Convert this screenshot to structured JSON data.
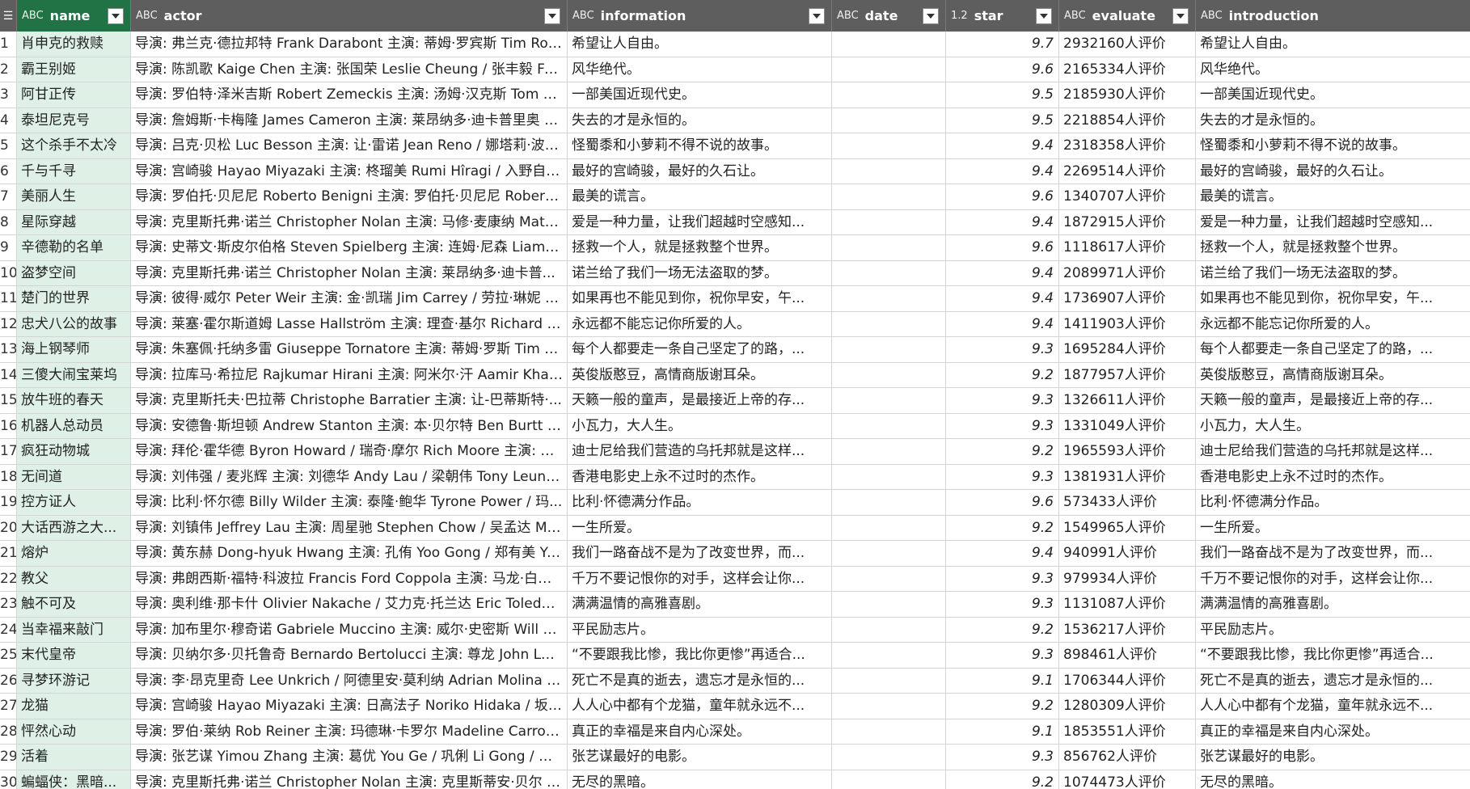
{
  "columns": [
    {
      "type": "ABC",
      "label": "name"
    },
    {
      "type": "ABC",
      "label": "actor"
    },
    {
      "type": "ABC",
      "label": "information"
    },
    {
      "type": "ABC",
      "label": "date"
    },
    {
      "type": "1.2",
      "label": "star"
    },
    {
      "type": "ABC",
      "label": "evaluate"
    },
    {
      "type": "ABC",
      "label": "introduction"
    }
  ],
  "rows": [
    {
      "num": "1",
      "name": "肖申克的救赎",
      "actor": "导演: 弗兰克·德拉邦特 Frank Darabont 主演: 蒂姆·罗宾斯 Tim Rob...",
      "information": "希望让人自由。",
      "date": "",
      "star": "9.7",
      "evaluate": "2932160人评价",
      "introduction": "希望让人自由。"
    },
    {
      "num": "2",
      "name": "霸王别姬",
      "actor": "导演: 陈凯歌 Kaige Chen 主演: 张国荣 Leslie Cheung / 张丰毅 Fengy...",
      "information": "风华绝代。",
      "date": "",
      "star": "9.6",
      "evaluate": "2165334人评价",
      "introduction": "风华绝代。"
    },
    {
      "num": "3",
      "name": "阿甘正传",
      "actor": "导演: 罗伯特·泽米吉斯 Robert Zemeckis 主演: 汤姆·汉克斯 Tom Ha...",
      "information": "一部美国近现代史。",
      "date": "",
      "star": "9.5",
      "evaluate": "2185930人评价",
      "introduction": "一部美国近现代史。"
    },
    {
      "num": "4",
      "name": "泰坦尼克号",
      "actor": "导演: 詹姆斯·卡梅隆 James Cameron 主演: 莱昂纳多·迪卡普里奥 L...",
      "information": "失去的才是永恒的。",
      "date": "",
      "star": "9.5",
      "evaluate": "2218854人评价",
      "introduction": "失去的才是永恒的。"
    },
    {
      "num": "5",
      "name": "这个杀手不太冷",
      "actor": "导演: 吕克·贝松 Luc Besson 主演: 让·雷诺 Jean Reno / 娜塔莉·波特...",
      "information": "怪蜀黍和小萝莉不得不说的故事。",
      "date": "",
      "star": "9.4",
      "evaluate": "2318358人评价",
      "introduction": "怪蜀黍和小萝莉不得不说的故事。"
    },
    {
      "num": "6",
      "name": "千与千寻",
      "actor": "导演: 宫崎骏 Hayao Miyazaki 主演: 柊瑠美 Rumi Hîragi / 入野自由 ...",
      "information": "最好的宫崎骏，最好的久石让。",
      "date": "",
      "star": "9.4",
      "evaluate": "2269514人评价",
      "introduction": "最好的宫崎骏，最好的久石让。"
    },
    {
      "num": "7",
      "name": "美丽人生",
      "actor": "导演: 罗伯托·贝尼尼 Roberto Benigni 主演: 罗伯托·贝尼尼 Roberto ...",
      "information": "最美的谎言。",
      "date": "",
      "star": "9.6",
      "evaluate": "1340707人评价",
      "introduction": "最美的谎言。"
    },
    {
      "num": "8",
      "name": "星际穿越",
      "actor": "导演: 克里斯托弗·诺兰 Christopher Nolan 主演: 马修·麦康纳 Matth...",
      "information": "爱是一种力量，让我们超越时空感知...",
      "date": "",
      "star": "9.4",
      "evaluate": "1872915人评价",
      "introduction": "爱是一种力量，让我们超越时空感知..."
    },
    {
      "num": "9",
      "name": "辛德勒的名单",
      "actor": "导演: 史蒂文·斯皮尔伯格 Steven Spielberg 主演: 连姆·尼森 Liam Ne...",
      "information": "拯救一个人，就是拯救整个世界。",
      "date": "",
      "star": "9.6",
      "evaluate": "1118617人评价",
      "introduction": "拯救一个人，就是拯救整个世界。"
    },
    {
      "num": "10",
      "name": "盗梦空间",
      "actor": "导演: 克里斯托弗·诺兰 Christopher Nolan 主演: 莱昂纳多·迪卡普...",
      "information": "诺兰给了我们一场无法盗取的梦。",
      "date": "",
      "star": "9.4",
      "evaluate": "2089971人评价",
      "introduction": "诺兰给了我们一场无法盗取的梦。"
    },
    {
      "num": "11",
      "name": "楚门的世界",
      "actor": "导演: 彼得·威尔 Peter Weir 主演: 金·凯瑞 Jim Carrey / 劳拉·琳妮 La...",
      "information": "如果再也不能见到你，祝你早安，午...",
      "date": "",
      "star": "9.4",
      "evaluate": "1736907人评价",
      "introduction": "如果再也不能见到你，祝你早安，午..."
    },
    {
      "num": "12",
      "name": "忠犬八公的故事",
      "actor": "导演: 莱塞·霍尔斯道姆 Lasse Hallström 主演: 理查·基尔 Richard Ge...",
      "information": "永远都不能忘记你所爱的人。",
      "date": "",
      "star": "9.4",
      "evaluate": "1411903人评价",
      "introduction": "永远都不能忘记你所爱的人。"
    },
    {
      "num": "13",
      "name": "海上钢琴师",
      "actor": "导演: 朱塞佩·托纳多雷 Giuseppe Tornatore 主演: 蒂姆·罗斯 Tim Ro...",
      "information": "每个人都要走一条自己坚定了的路，...",
      "date": "",
      "star": "9.3",
      "evaluate": "1695284人评价",
      "introduction": "每个人都要走一条自己坚定了的路，..."
    },
    {
      "num": "14",
      "name": "三傻大闹宝莱坞",
      "actor": "导演: 拉库马·希拉尼 Rajkumar Hirani 主演: 阿米尔·汗 Aamir Khan / ...",
      "information": "英俊版憨豆，高情商版谢耳朵。",
      "date": "",
      "star": "9.2",
      "evaluate": "1877957人评价",
      "introduction": "英俊版憨豆，高情商版谢耳朵。"
    },
    {
      "num": "15",
      "name": "放牛班的春天",
      "actor": "导演: 克里斯托夫·巴拉蒂 Christophe Barratier 主演: 让-巴蒂斯特·...",
      "information": "天籁一般的童声，是最接近上帝的存...",
      "date": "",
      "star": "9.3",
      "evaluate": "1326611人评价",
      "introduction": "天籁一般的童声，是最接近上帝的存..."
    },
    {
      "num": "16",
      "name": "机器人总动员",
      "actor": "导演: 安德鲁·斯坦顿 Andrew Stanton 主演: 本·贝尔特 Ben Burtt / ...",
      "information": "小瓦力，大人生。",
      "date": "",
      "star": "9.3",
      "evaluate": "1331049人评价",
      "introduction": "小瓦力，大人生。"
    },
    {
      "num": "17",
      "name": "疯狂动物城",
      "actor": "导演: 拜伦·霍华德 Byron Howard / 瑞奇·摩尔 Rich Moore 主演: 金...",
      "information": "迪士尼给我们营造的乌托邦就是这样...",
      "date": "",
      "star": "9.2",
      "evaluate": "1965593人评价",
      "introduction": "迪士尼给我们营造的乌托邦就是这样..."
    },
    {
      "num": "18",
      "name": "无间道",
      "actor": "导演: 刘伟强 / 麦兆辉 主演: 刘德华 Andy Lau / 梁朝伟 Tony Leung ...",
      "information": "香港电影史上永不过时的杰作。",
      "date": "",
      "star": "9.3",
      "evaluate": "1381931人评价",
      "introduction": "香港电影史上永不过时的杰作。"
    },
    {
      "num": "19",
      "name": "控方证人",
      "actor": "导演: 比利·怀尔德 Billy Wilder 主演: 泰隆·鲍华 Tyrone Power / 玛...",
      "information": "比利·怀德满分作品。",
      "date": "",
      "star": "9.6",
      "evaluate": "573433人评价",
      "introduction": "比利·怀德满分作品。"
    },
    {
      "num": "20",
      "name": "大话西游之大...",
      "actor": "导演: 刘镇伟 Jeffrey Lau 主演: 周星驰 Stephen Chow / 吴孟达 Man ...",
      "information": "一生所爱。",
      "date": "",
      "star": "9.2",
      "evaluate": "1549965人评价",
      "introduction": "一生所爱。"
    },
    {
      "num": "21",
      "name": "熔炉",
      "actor": "导演: 黄东赫 Dong-hyuk Hwang 主演: 孔侑 Yoo Gong / 郑有美 Yu-m...",
      "information": "我们一路奋战不是为了改变世界，而...",
      "date": "",
      "star": "9.4",
      "evaluate": "940991人评价",
      "introduction": "我们一路奋战不是为了改变世界，而..."
    },
    {
      "num": "22",
      "name": "教父",
      "actor": "导演: 弗朗西斯·福特·科波拉 Francis Ford Coppola 主演: 马龙·白兰...",
      "information": "千万不要记恨你的对手，这样会让你...",
      "date": "",
      "star": "9.3",
      "evaluate": "979934人评价",
      "introduction": "千万不要记恨你的对手，这样会让你..."
    },
    {
      "num": "23",
      "name": "触不可及",
      "actor": "导演: 奥利维·那卡什 Olivier Nakache / 艾力克·托兰达 Eric Toledano ...",
      "information": "满满温情的高雅喜剧。",
      "date": "",
      "star": "9.3",
      "evaluate": "1131087人评价",
      "introduction": "满满温情的高雅喜剧。"
    },
    {
      "num": "24",
      "name": "当幸福来敲门",
      "actor": "导演: 加布里尔·穆奇诺 Gabriele Muccino 主演: 威尔·史密斯 Will S...",
      "information": "平民励志片。",
      "date": "",
      "star": "9.2",
      "evaluate": "1536217人评价",
      "introduction": "平民励志片。"
    },
    {
      "num": "25",
      "name": "末代皇帝",
      "actor": "导演: 贝纳尔多·贝托鲁奇 Bernardo Bertolucci 主演: 尊龙 John Lone...",
      "information": "“不要跟我比惨，我比你更惨”再适合...",
      "date": "",
      "star": "9.3",
      "evaluate": "898461人评价",
      "introduction": "“不要跟我比惨，我比你更惨”再适合..."
    },
    {
      "num": "26",
      "name": "寻梦环游记",
      "actor": "导演: 李·昂克里奇 Lee Unkrich / 阿德里安·莫利纳 Adrian Molina 主...",
      "information": "死亡不是真的逝去，遗忘才是永恒的...",
      "date": "",
      "star": "9.1",
      "evaluate": "1706344人评价",
      "introduction": "死亡不是真的逝去，遗忘才是永恒的..."
    },
    {
      "num": "27",
      "name": "龙猫",
      "actor": "导演: 宫崎骏 Hayao Miyazaki 主演: 日高法子 Noriko Hidaka / 坂本...",
      "information": "人人心中都有个龙猫，童年就永远不...",
      "date": "",
      "star": "9.2",
      "evaluate": "1280309人评价",
      "introduction": "人人心中都有个龙猫，童年就永远不..."
    },
    {
      "num": "28",
      "name": "怦然心动",
      "actor": "导演: 罗伯·莱纳 Rob Reiner 主演: 玛德琳·卡罗尔 Madeline Carroll / ...",
      "information": "真正的幸福是来自内心深处。",
      "date": "",
      "star": "9.1",
      "evaluate": "1853551人评价",
      "introduction": "真正的幸福是来自内心深处。"
    },
    {
      "num": "29",
      "name": "活着",
      "actor": "导演: 张艺谋 Yimou Zhang 主演: 葛优 You Ge / 巩俐 Li Gong / 姜武 ...",
      "information": "张艺谋最好的电影。",
      "date": "",
      "star": "9.3",
      "evaluate": "856762人评价",
      "introduction": "张艺谋最好的电影。"
    },
    {
      "num": "30",
      "name": "蝙蝠侠：黑暗...",
      "actor": "导演: 克里斯托弗·诺兰 Christopher Nolan 主演: 克里斯蒂安·贝尔 C...",
      "information": "无尽的黑暗。",
      "date": "",
      "star": "9.2",
      "evaluate": "1074473人评价",
      "introduction": "无尽的黑暗。"
    }
  ]
}
